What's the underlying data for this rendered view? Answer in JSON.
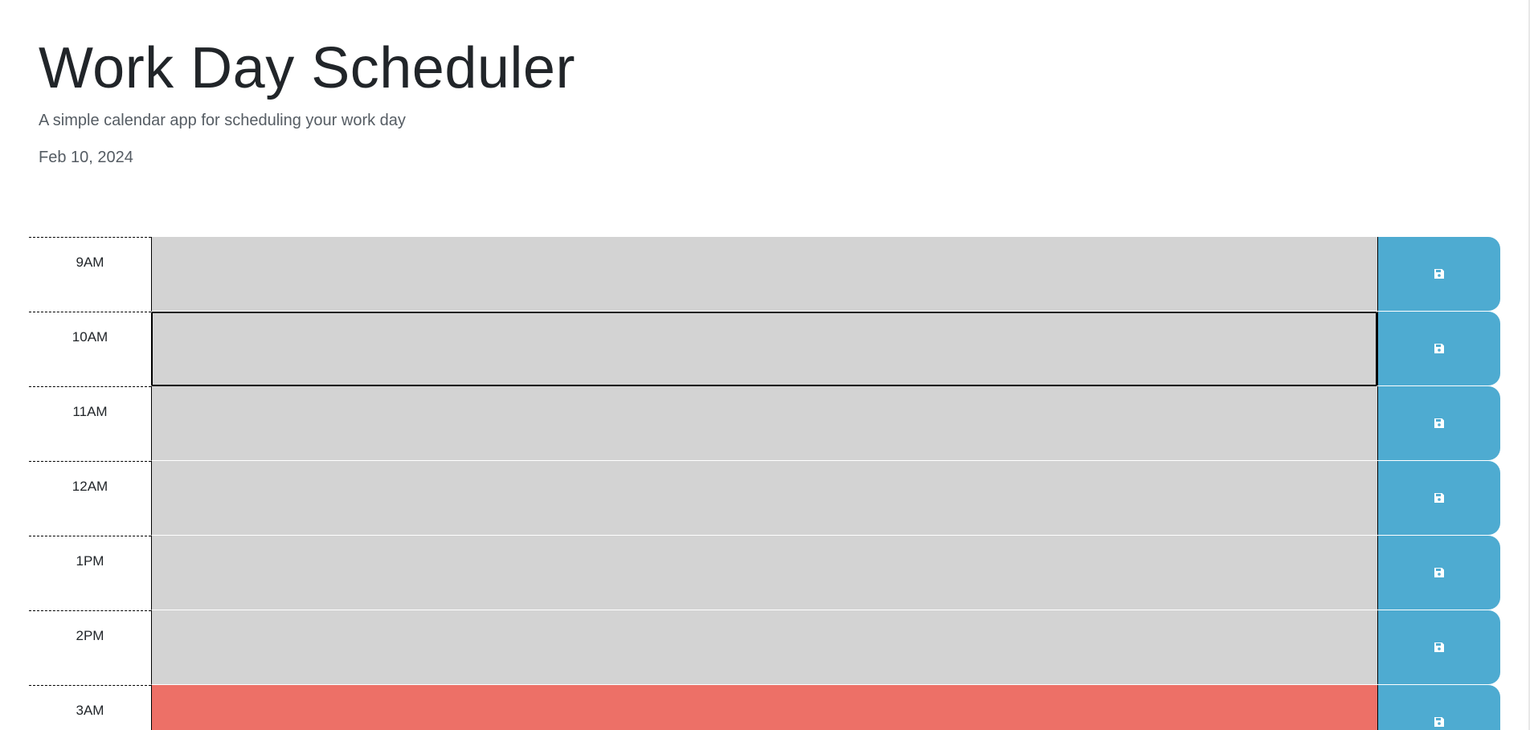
{
  "header": {
    "title": "Work Day Scheduler",
    "subtitle": "A simple calendar app for scheduling your work day",
    "date": "Feb 10, 2024"
  },
  "colors": {
    "past": "#d3d3d3",
    "present": "#ed7067",
    "save_button": "#4eabd1"
  },
  "rows": [
    {
      "hour": "9AM",
      "text": "",
      "state": "past",
      "icon": "save-icon"
    },
    {
      "hour": "10AM",
      "text": "",
      "state": "past",
      "icon": "save-icon"
    },
    {
      "hour": "11AM",
      "text": "",
      "state": "past",
      "icon": "save-icon"
    },
    {
      "hour": "12AM",
      "text": "",
      "state": "past",
      "icon": "save-icon"
    },
    {
      "hour": "1PM",
      "text": "",
      "state": "past",
      "icon": "save-icon"
    },
    {
      "hour": "2PM",
      "text": "",
      "state": "past",
      "icon": "save-icon"
    },
    {
      "hour": "3AM",
      "text": "",
      "state": "present",
      "icon": "save-icon"
    }
  ]
}
